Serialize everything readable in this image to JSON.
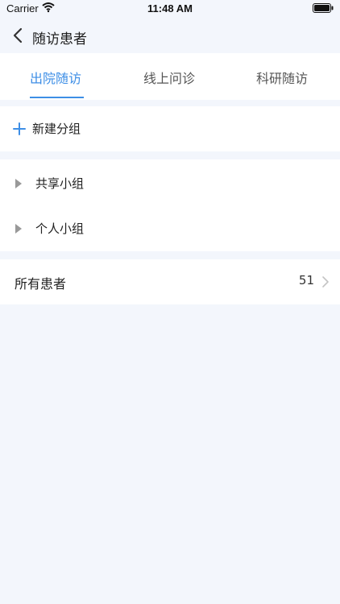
{
  "status_bar": {
    "carrier": "Carrier",
    "time": "11:48 AM"
  },
  "nav": {
    "title": "随访患者"
  },
  "tabs": [
    {
      "label": "出院随访",
      "active": true
    },
    {
      "label": "线上问诊",
      "active": false
    },
    {
      "label": "科研随访",
      "active": false
    }
  ],
  "actions": {
    "new_group_label": "新建分组"
  },
  "groups": [
    {
      "label": "共享小组"
    },
    {
      "label": "个人小组"
    }
  ],
  "all_patients": {
    "label": "所有患者",
    "count": "51"
  },
  "colors": {
    "accent": "#3d8ee6",
    "background": "#f3f6fc",
    "card": "#ffffff"
  },
  "icons": {
    "back": "chevron-left-icon",
    "add": "plus-icon",
    "expand": "triangle-right-icon",
    "more": "chevron-right-icon",
    "wifi": "wifi-icon",
    "battery": "battery-icon"
  }
}
